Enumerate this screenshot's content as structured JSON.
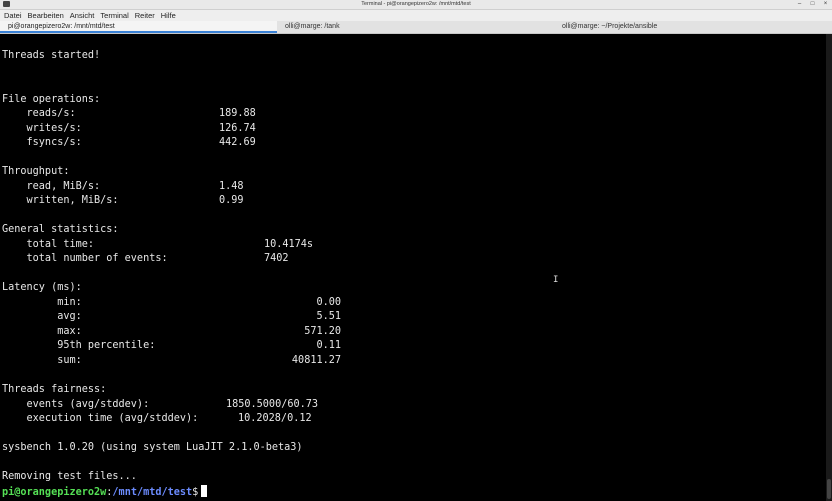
{
  "window": {
    "title": "Terminal - pi@orangepizero2w: /mnt/mtd/test",
    "controls": [
      "–",
      "□",
      "×"
    ]
  },
  "menu": [
    "Datei",
    "Bearbeiten",
    "Ansicht",
    "Terminal",
    "Reiter",
    "Hilfe"
  ],
  "tabs": [
    {
      "label": "pi@orangepizero2w: /mnt/mtd/test",
      "active": true
    },
    {
      "label": "olli@marge: /tank",
      "active": false
    },
    {
      "label": "olli@marge: ~/Projekte/ansible",
      "active": false
    }
  ],
  "output": {
    "threads_started": "Threads started!",
    "file_ops_header": "File operations:",
    "reads_label": "    reads/s:",
    "reads_value": "189.88",
    "writes_label": "    writes/s:",
    "writes_value": "126.74",
    "fsyncs_label": "    fsyncs/s:",
    "fsyncs_value": "442.69",
    "throughput_header": "Throughput:",
    "read_mib_label": "    read, MiB/s:",
    "read_mib_value": "1.48",
    "written_mib_label": "    written, MiB/s:",
    "written_mib_value": "0.99",
    "general_header": "General statistics:",
    "total_time_label": "    total time:",
    "total_time_value": "10.4174s",
    "total_events_label": "    total number of events:",
    "total_events_value": "7402",
    "latency_header": "Latency (ms):",
    "min_label": "         min:",
    "min_value": "0.00",
    "avg_label": "         avg:",
    "avg_value": "5.51",
    "max_label": "         max:",
    "max_value": "571.20",
    "p95_label": "         95th percentile:",
    "p95_value": "0.11",
    "sum_label": "         sum:",
    "sum_value": "40811.27",
    "fairness_header": "Threads fairness:",
    "events_label": "    events (avg/stddev):",
    "events_value": "1850.5000/60.73",
    "exec_label": "    execution time (avg/stddev):",
    "exec_value": "10.2028/0.12",
    "sysbench_version": "sysbench 1.0.20 (using system LuaJIT 2.1.0-beta3)",
    "removing": "Removing test files...",
    "prompt_user": "pi@orangepizero2w",
    "prompt_sep": ":",
    "prompt_path": "/mnt/mtd/test",
    "prompt_symbol": "$"
  }
}
